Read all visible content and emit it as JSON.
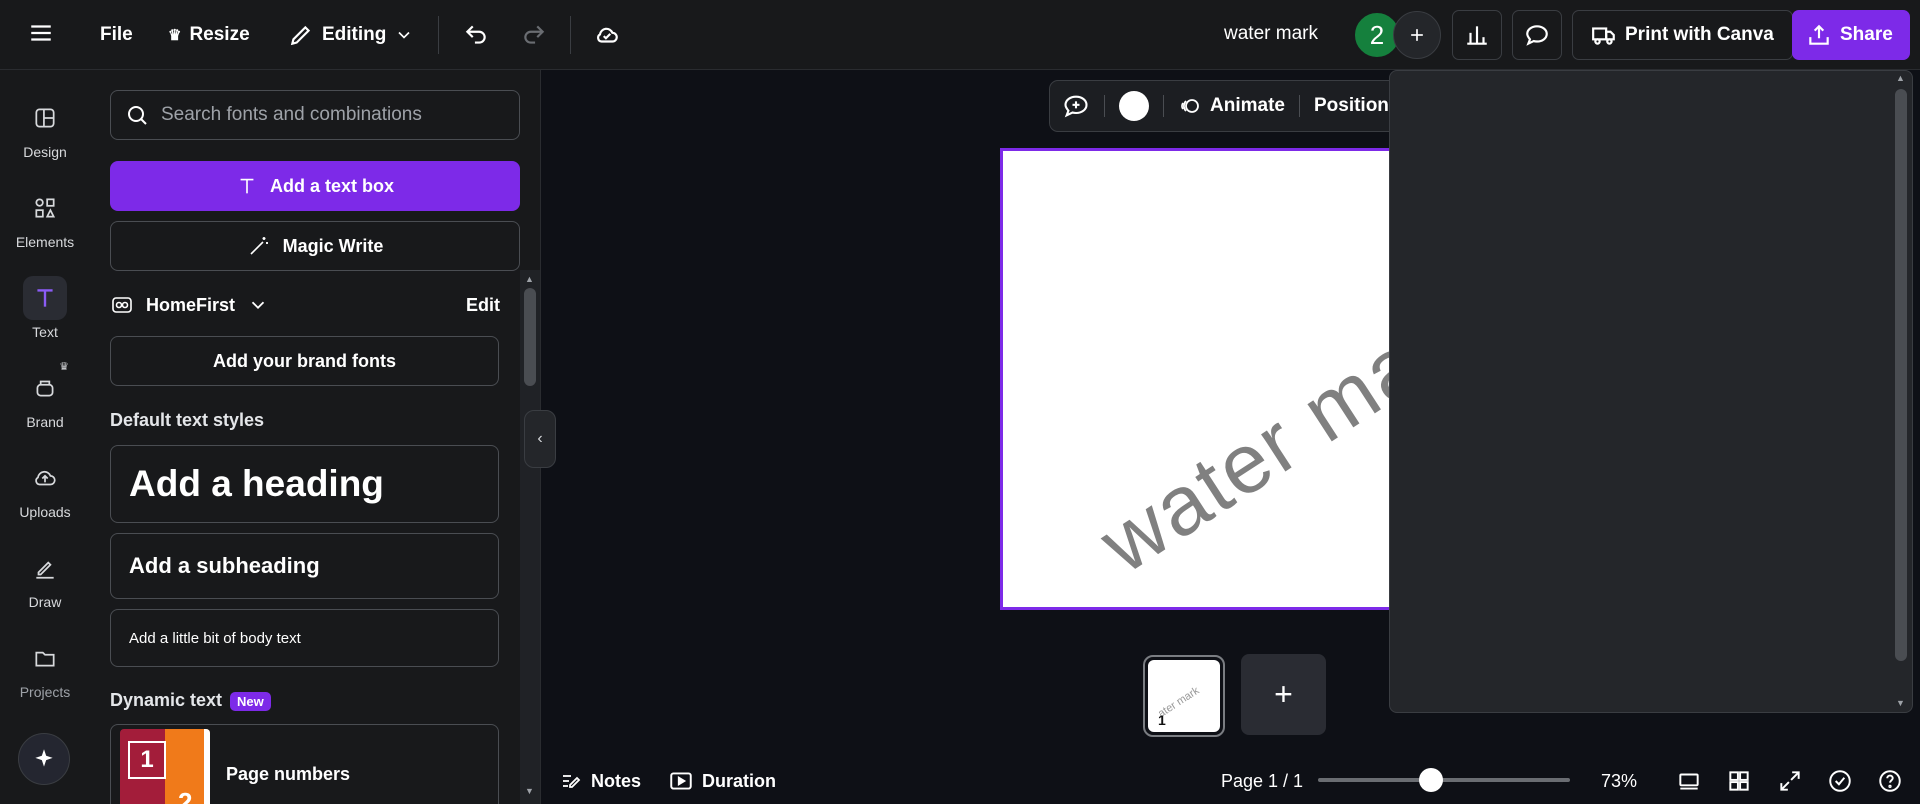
{
  "topbar": {
    "file_label": "File",
    "resize_label": "Resize",
    "editing_label": "Editing",
    "document_title": "water mark",
    "collaborator_count": "2",
    "print_label": "Print with Canva",
    "share_label": "Share"
  },
  "rail": {
    "items": [
      {
        "label": "Design",
        "icon": "design-icon"
      },
      {
        "label": "Elements",
        "icon": "elements-icon"
      },
      {
        "label": "Text",
        "icon": "text-icon"
      },
      {
        "label": "Brand",
        "icon": "brand-icon"
      },
      {
        "label": "Uploads",
        "icon": "uploads-icon"
      },
      {
        "label": "Draw",
        "icon": "draw-icon"
      },
      {
        "label": "Projects",
        "icon": "projects-icon"
      }
    ],
    "active": "Text"
  },
  "panel": {
    "search_placeholder": "Search fonts and combinations",
    "add_text_box": "Add a text box",
    "magic_write": "Magic Write",
    "brand_name": "HomeFirst",
    "brand_edit": "Edit",
    "add_brand_fonts": "Add your brand fonts",
    "default_styles_title": "Default text styles",
    "heading": "Add a heading",
    "subheading": "Add a subheading",
    "body": "Add a little bit of body text",
    "dynamic_title": "Dynamic text",
    "new_badge": "New",
    "page_numbers": "Page numbers"
  },
  "canvas": {
    "animate_label": "Animate",
    "position_label": "Position",
    "watermark_text": "water mark",
    "thumb_number": "1",
    "thumb_text": "ater mark"
  },
  "bottombar": {
    "notes_label": "Notes",
    "duration_label": "Duration",
    "page_indicator": "Page 1 / 1",
    "zoom_level": "73%",
    "zoom_fraction": 0.45
  },
  "colors": {
    "accent": "#7d2ae8",
    "background": "#0e1016",
    "surface": "#18191b",
    "collaborator_avatar": "#15803d"
  }
}
